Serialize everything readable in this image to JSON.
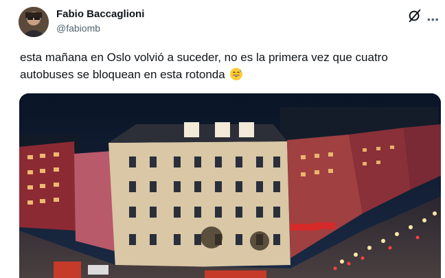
{
  "tweet": {
    "author": {
      "name": "Fabio Baccaglioni",
      "handle": "@fabiomb",
      "avatar_icon": "user-avatar"
    },
    "text": "esta mañana en Oslo volvió a suceder, no es la primera vez que cuatro autobuses se bloquean en esta rotonda",
    "emoji_icon": "grinning-sweat-emoji",
    "media": {
      "description_icon": "photo-night-street-buses-roundabout"
    }
  },
  "header": {
    "grok_icon": "grok-icon",
    "more_icon": "more-icon"
  },
  "colors": {
    "text": "#0f1419",
    "secondary": "#536471",
    "background": "#ffffff"
  }
}
